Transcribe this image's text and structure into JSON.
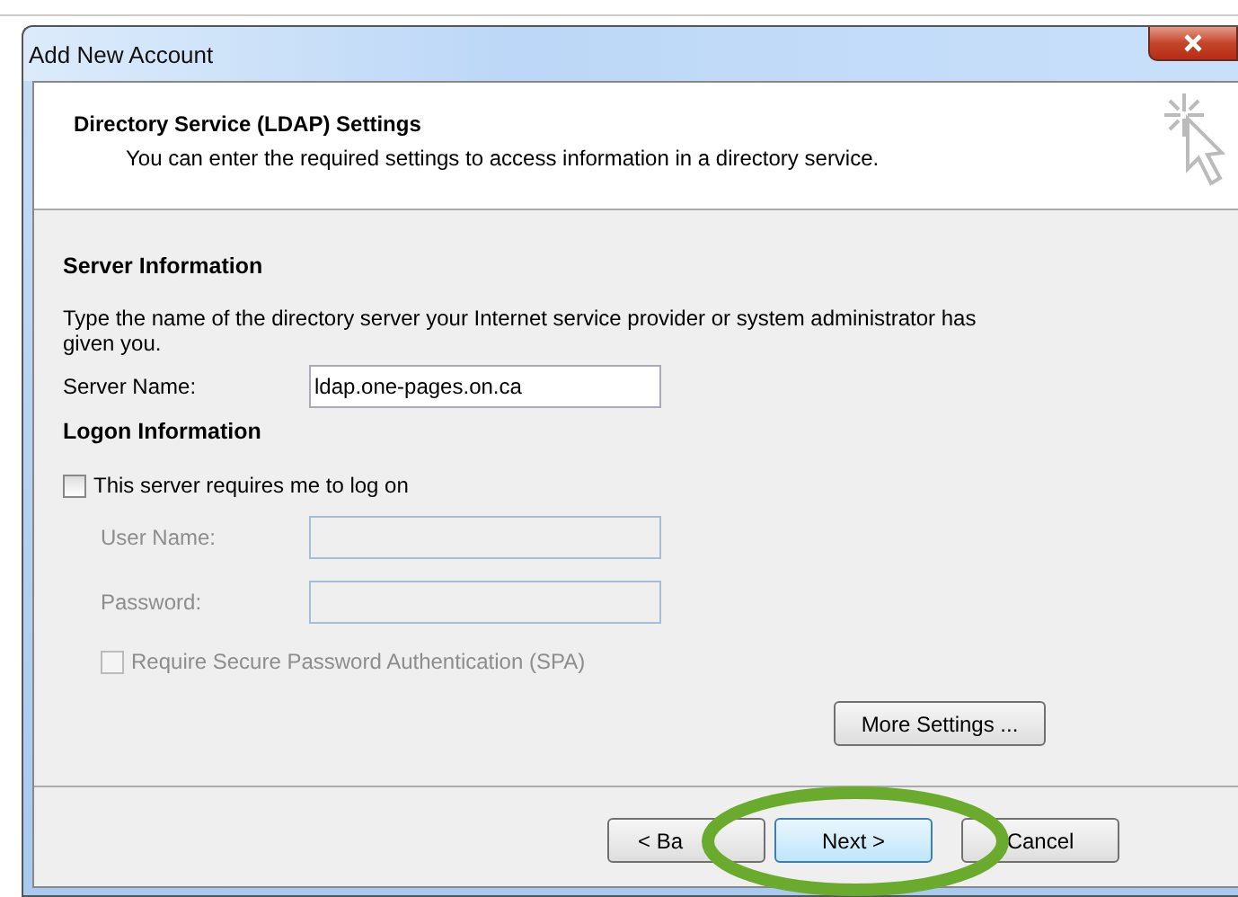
{
  "window": {
    "title": "Add New Account"
  },
  "header": {
    "title": "Directory Service (LDAP) Settings",
    "subtitle": "You can enter the required settings to access information in a directory service."
  },
  "server_section": {
    "heading": "Server Information",
    "description": "Type the name of the directory server your Internet service provider or system administrator has given you.",
    "server_name": {
      "label": "Server Name:",
      "value": "ldap.one-pages.on.ca",
      "disabled": false
    }
  },
  "logon_section": {
    "heading": "Logon Information",
    "requires_logon": {
      "label": "This server requires me to log on",
      "checked": false,
      "disabled": false
    },
    "fields": [
      {
        "label": "User Name:",
        "disabled": true
      },
      {
        "label": "Password:",
        "disabled": true
      }
    ],
    "spa": {
      "label": "Require Secure Password Authentication (SPA)",
      "checked": false,
      "disabled": true
    }
  },
  "more_settings": {
    "label": "More Settings ..."
  },
  "buttons": [
    {
      "label": "< Ba",
      "default": false
    },
    {
      "label": "Next >",
      "default": true
    },
    {
      "label": "Cancel",
      "default": false
    }
  ]
}
